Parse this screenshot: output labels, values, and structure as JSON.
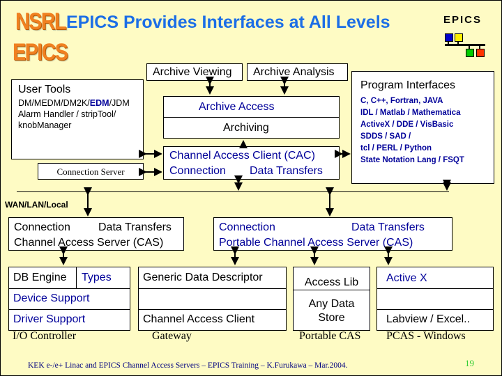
{
  "logo": {
    "line1": "NSRL",
    "line2": "EPICS"
  },
  "title": "EPICS Provides Interfaces at All Levels",
  "epics_badge": {
    "label": "EPICS",
    "colors": [
      "#0000cc",
      "#ffee00",
      "#00cc00",
      "#ff3300"
    ]
  },
  "archive": {
    "viewing": "Archive Viewing",
    "analysis": "Archive Analysis",
    "access": "Archive Access",
    "archiving": "Archiving"
  },
  "user_tools": {
    "title": "User Tools",
    "line1_prefix": "DM/MEDM/DM2K/",
    "line1_highlight": "EDM",
    "line1_suffix": "/JDM",
    "line2": "Alarm Handler / stripTool/",
    "line3": "knobManager"
  },
  "connection_server": "Connection Server",
  "cac": {
    "title": "Channel Access Client (CAC)",
    "left": "Connection",
    "right": "Data Transfers"
  },
  "program_interfaces": {
    "title": "Program Interfaces",
    "items": [
      "C, C++, Fortran, JAVA",
      "IDL / Matlab / Mathematica",
      "ActiveX / DDE / VisBasic",
      "SDDS / SAD /",
      "tcl / PERL / Python",
      "State Notation Lang / FSQT"
    ]
  },
  "network_label": "WAN/LAN/Local",
  "cas": {
    "left": "Connection",
    "right": "Data Transfers",
    "title": "Channel Access Server (CAS)"
  },
  "pcas": {
    "left": "Connection",
    "right": "Data Transfers",
    "title": "Portable Channel Access Server (CAS)"
  },
  "ioc": {
    "db_engine": "DB Engine",
    "types": "Types",
    "device_support": "Device Support",
    "driver_support": "Driver Support",
    "caption": "I/O Controller"
  },
  "gateway": {
    "gdd": "Generic Data Descriptor",
    "cac": "Channel Access Client",
    "caption": "Gateway"
  },
  "portable_cas": {
    "access_lib": "Access Lib",
    "store_line1": "Any Data",
    "store_line2": "Store",
    "caption": "Portable CAS"
  },
  "pcas_windows": {
    "activex": "Active X",
    "labview": "Labview / Excel..",
    "caption": "PCAS - Windows"
  },
  "footer": {
    "text": "KEK e-/e+ Linac and EPICS Channel Access Servers – EPICS Training – K.Furukawa – Mar.2004.",
    "page": "19"
  }
}
